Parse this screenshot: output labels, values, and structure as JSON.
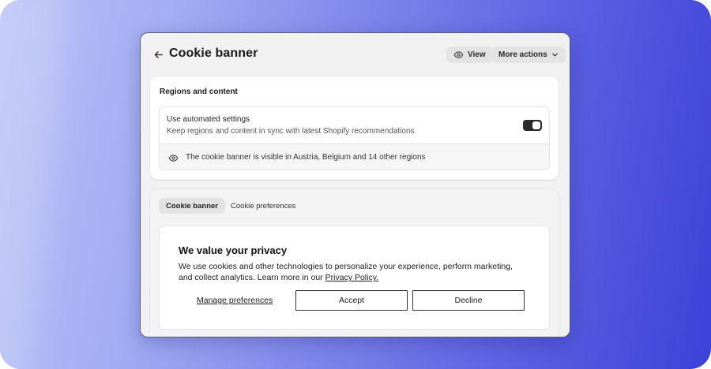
{
  "header": {
    "title": "Cookie banner",
    "view_label": "View",
    "more_actions_label": "More actions"
  },
  "regions": {
    "heading": "Regions and content",
    "auto_title": "Use automated settings",
    "auto_description": "Keep regions and content in sync with latest Shopify recommendations",
    "auto_enabled": true,
    "visibility_text": "The cookie banner is visible in Austria, Belgium and 14 other regions"
  },
  "tabs": [
    {
      "label": "Cookie banner",
      "active": true
    },
    {
      "label": "Cookie preferences",
      "active": false
    }
  ],
  "banner": {
    "title": "We value your privacy",
    "text": "We use cookies and other technologies to personalize your experience, perform marketing, and collect analytics. Learn more in our ",
    "policy_link": "Privacy Policy.",
    "manage_label": "Manage preferences",
    "accept_label": "Accept",
    "decline_label": "Decline"
  },
  "icons": {
    "back": "arrow-left-icon",
    "view": "eye-icon",
    "more": "chevron-down-icon",
    "visibility": "eye-icon"
  },
  "colors": {
    "background_gradient_start": "#b9c1f6",
    "background_gradient_end": "#3c42d9",
    "toggle_on": "#2a2a2a"
  }
}
